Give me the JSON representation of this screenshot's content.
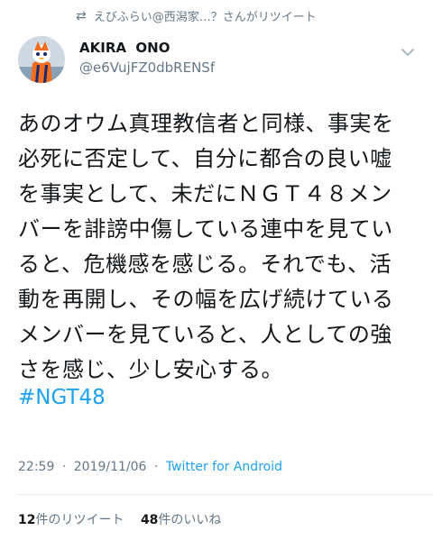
{
  "retweet_header": {
    "text": "えびふらい@西潟家…？さんがリツイート",
    "icon": "retweet-icon"
  },
  "user": {
    "name": "AKIRA  ONO",
    "handle": "@e6VujFZ0dbRENSf",
    "avatar": "avatar-mascot"
  },
  "tweet": {
    "lines": [
      "あのオウム真理教信者と同様、事実を",
      "必死に否定して、自分に都合の良い嘘",
      "を事実として、未だにＮＧＴ４８メン",
      "バーを誹謗中傷している連中を見てい",
      "ると、危機感を感じる。それでも、活",
      "動を再開し、その幅を広げ続けている",
      "メンバーを見ていると、人としての強",
      "さを感じ、少し安心する。"
    ],
    "hashtag": "#NGT48"
  },
  "meta": {
    "time": "22:59",
    "date": "2019/11/06",
    "source": "Twitter for Android",
    "separator": "·"
  },
  "stats": {
    "retweets_count": "12",
    "retweets_label": "件のリツイート",
    "likes_count": "48",
    "likes_label": "件のいいね"
  },
  "colors": {
    "link": "#1da1f2",
    "secondary": "#657786",
    "text": "#14171a"
  }
}
